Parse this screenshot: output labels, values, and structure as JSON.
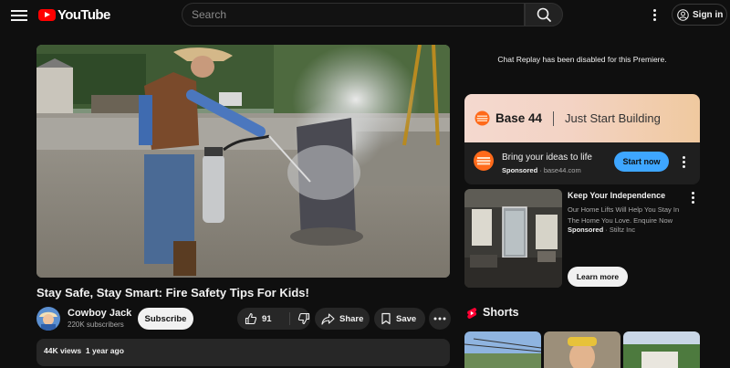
{
  "header": {
    "logo_text": "YouTube",
    "search_placeholder": "Search",
    "signin_label": "Sign in"
  },
  "video": {
    "title": "Stay Safe, Stay Smart: Fire Safety Tips For Kids!",
    "channel_name": "Cowboy Jack",
    "subscribers": "220K subscribers",
    "subscribe_label": "Subscribe",
    "likes": "91",
    "share_label": "Share",
    "save_label": "Save",
    "views": "44K views",
    "age": "1 year ago"
  },
  "sidebar": {
    "chat_message": "Chat Replay has been disabled for this Premiere.",
    "ad1": {
      "brand": "Base 44",
      "tagline": "Just Start Building",
      "headline": "Bring your ideas to life",
      "sponsored": "Sponsored",
      "domain": "base44.com",
      "cta": "Start now"
    },
    "ad2": {
      "title": "Keep Your Independence",
      "body": "Our Home Lifts Will Help You Stay In The Home You Love. Enquire Now",
      "sponsored": "Sponsored",
      "advertiser": "Stiltz Inc",
      "cta": "Learn more"
    },
    "shorts_title": "Shorts"
  },
  "colors": {
    "background": "#0f0f0f",
    "youtube_red": "#ff0000",
    "cta_blue": "#3ea6ff",
    "pill_bg": "#272727"
  },
  "icons": [
    "menu-icon",
    "youtube-logo-icon",
    "search-icon",
    "more-vert-icon",
    "account-icon",
    "thumb-up-icon",
    "thumb-down-icon",
    "share-icon",
    "save-icon",
    "more-horiz-icon",
    "shorts-icon"
  ]
}
